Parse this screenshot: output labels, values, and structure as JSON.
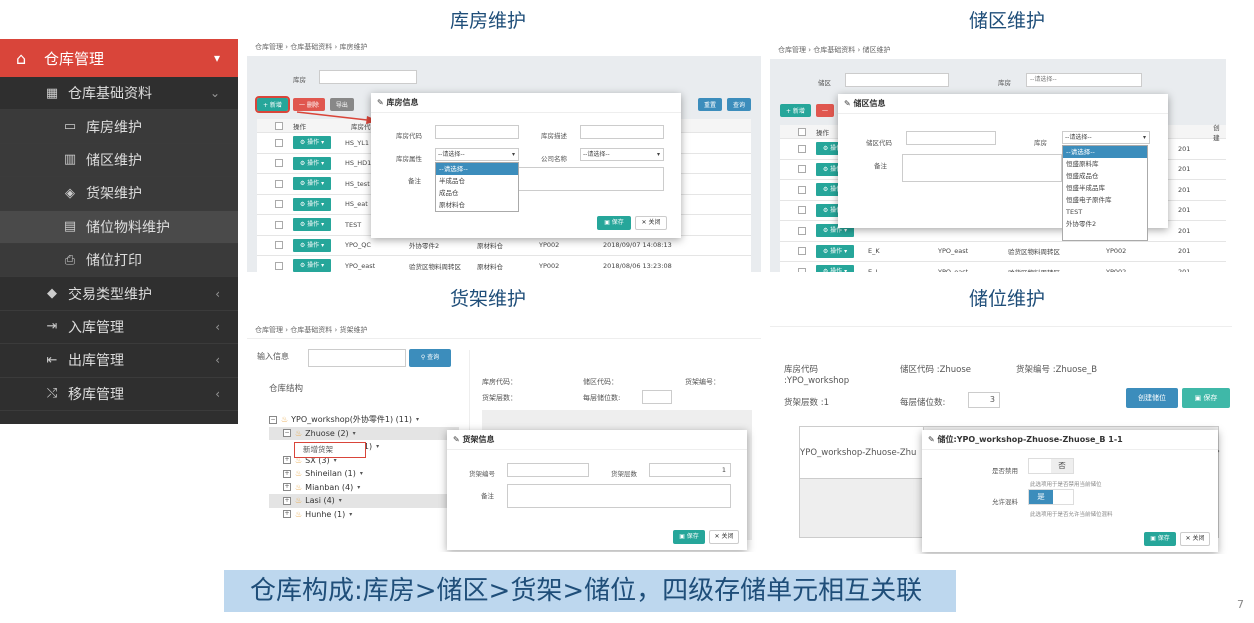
{
  "titles": {
    "warehouse": "库房维护",
    "zone": "储区维护",
    "rack": "货架维护",
    "location": "储位维护"
  },
  "sidebar": {
    "header": "仓库管理",
    "items": [
      {
        "label": "仓库基础资料",
        "level": 1,
        "icon": "grid-icon",
        "chevron": "down"
      },
      {
        "label": "库房维护",
        "level": 2,
        "icon": "inbox-icon"
      },
      {
        "label": "储区维护",
        "level": 2,
        "icon": "map-icon"
      },
      {
        "label": "货架维护",
        "level": 2,
        "icon": "layers-icon"
      },
      {
        "label": "储位物料维护",
        "level": 2,
        "icon": "film-icon",
        "active": true
      },
      {
        "label": "储位打印",
        "level": 2,
        "icon": "printer-icon"
      },
      {
        "label": "交易类型维护",
        "level": 1,
        "icon": "tag-icon",
        "chevron": "left"
      },
      {
        "label": "入库管理",
        "level": 1,
        "icon": "sign-in-icon",
        "chevron": "left"
      },
      {
        "label": "出库管理",
        "level": 1,
        "icon": "sign-out-icon",
        "chevron": "left"
      },
      {
        "label": "移库管理",
        "level": 1,
        "icon": "shuffle-icon",
        "chevron": "left"
      }
    ]
  },
  "p1": {
    "breadcrumb": "仓库管理 › 仓库基础资料 › 库房维护",
    "filter_label": "库房",
    "btn_add": "+ 新增",
    "btn_del": "一 删除",
    "btn_export": "导出",
    "btn_reset": "重置",
    "btn_query": "查询",
    "col_op": "操作",
    "col_code": "库房代码",
    "col_time": "时间",
    "op_label": "操作",
    "rows": [
      {
        "code": "HS_YL1",
        "a": "",
        "b": "",
        "c": "",
        "time": "/11/09 10:00:38"
      },
      {
        "code": "HS_HD1",
        "a": "",
        "b": "",
        "c": "",
        "time": "/11/09 10:00:03"
      },
      {
        "code": "HS_test",
        "a": "",
        "b": "",
        "c": "",
        "time": "/11/09 09:59:05"
      },
      {
        "code": "HS_eat",
        "a": "",
        "b": "",
        "c": "",
        "time": "/11/09 09:58:41"
      },
      {
        "code": "TEST",
        "a": "",
        "b": "",
        "c": "",
        "time": "/11/05 21:57:14"
      },
      {
        "code": "YPO_QC",
        "a": "外协零件2",
        "b": "原材料仓",
        "c": "YP002",
        "time": "2018/09/07 14:08:13"
      },
      {
        "code": "YPO_east",
        "a": "验货区物料周转区",
        "b": "原材料仓",
        "c": "YP002",
        "time": "2018/08/06 13:23:08"
      }
    ],
    "modal": {
      "title": "库房信息",
      "code_label": "库房代码",
      "desc_label": "库房描述",
      "attr_label": "库房属性",
      "company_label": "公司名称",
      "remark_label": "备注",
      "attr_value": "--请选择--",
      "company_value": "--请选择--",
      "options": [
        "--请选择--",
        "半成品仓",
        "成品仓",
        "原材料仓"
      ],
      "save": "保存",
      "close": "关闭"
    }
  },
  "p2": {
    "breadcrumb": "仓库管理 › 仓库基础资料 › 储区维护",
    "filter_zone": "储区",
    "filter_wh": "库房",
    "filter_wh_value": "--请选择--",
    "btn_add": "+ 新增",
    "col_op": "操作",
    "col_create": "创建",
    "op_label": "操作",
    "rows": [
      {
        "code": "",
        "wh": "",
        "zone": "",
        "c": "",
        "d": "201"
      },
      {
        "code": "",
        "wh": "",
        "zone": "",
        "c": "",
        "d": "201"
      },
      {
        "code": "",
        "wh": "",
        "zone": "",
        "c": "",
        "d": "201"
      },
      {
        "code": "",
        "wh": "",
        "zone": "",
        "c": "",
        "d": "201"
      },
      {
        "code": "",
        "wh": "",
        "zone": "",
        "c": "",
        "d": "201"
      },
      {
        "code": "E_K",
        "wh": "YPO_east",
        "zone": "验货区物料周转区",
        "c": "YP002",
        "d": "201"
      },
      {
        "code": "E_J",
        "wh": "YPO_east",
        "zone": "验货区物料周转区...",
        "c": "YP002",
        "d": "201"
      }
    ],
    "modal": {
      "title": "储区信息",
      "code_label": "储区代码",
      "wh_label": "库房",
      "remark_label": "备注",
      "wh_value": "--请选择--",
      "options": [
        "--请选择--",
        "恒盛原料库",
        "恒盛成品仓",
        "恒盛半成品库",
        "恒盛电子原件库",
        "TEST",
        "外协零件2"
      ]
    }
  },
  "p3": {
    "breadcrumb": "仓库管理 › 仓库基础资料 › 货架维护",
    "input_label": "输入信息",
    "query": "查询",
    "tree_title": "仓库结构",
    "tree": [
      {
        "label": "YPO_workshop(外协零件1) (11)",
        "indent": 0,
        "pm": "−"
      },
      {
        "label": "Zhuose (2)",
        "indent": 1,
        "pm": "−",
        "hl": true
      },
      {
        "label": "Zhuose_A (1)",
        "indent": 2,
        "pm": ""
      },
      {
        "label": "SX (3)",
        "indent": 1,
        "pm": "+"
      },
      {
        "label": "Shineilan (1)",
        "indent": 1,
        "pm": "+"
      },
      {
        "label": "Mianban (4)",
        "indent": 1,
        "pm": "+"
      },
      {
        "label": "Lasi (4)",
        "indent": 1,
        "pm": "+",
        "hl": true
      },
      {
        "label": "Hunhe (1)",
        "indent": 1,
        "pm": "+"
      }
    ],
    "context_menu": "新增货架",
    "info_wh": "库房代码：",
    "info_zone": "储区代码：",
    "info_rack": "货架编号：",
    "info_layers": "货架层数：",
    "info_per_layer": "每层储位数:",
    "modal": {
      "title": "货架信息",
      "rack_label": "货架编号",
      "layers_label": "货架层数",
      "layers_value": "1",
      "remark_label": "备注",
      "save": "保存",
      "close": "关闭"
    }
  },
  "p4": {
    "wh_code": "库房代码",
    "wh_value": ":YPO_workshop",
    "zone_code": "储区代码 :Zhuose",
    "rack_code": "货架编号 :Zhuose_B",
    "layers": "货架层数 :1",
    "per_layer_label": "每层储位数:",
    "per_layer_value": "3",
    "btn_create": "创建储位",
    "btn_save": "保存",
    "cell_text": "YPO_workshop-Zhuose-Zhu",
    "modal": {
      "title": "储位:YPO_workshop-Zhuose-Zhuose_B 1-1",
      "disable_label": "是否禁用",
      "disable_value": "否",
      "disable_hint": "此选项用于是否禁用当前储位",
      "mix_label": "允许混料",
      "mix_value": "是",
      "mix_hint": "此选项用于是否允许当前储位混料",
      "save": "保存",
      "close": "关闭"
    }
  },
  "caption": "仓库构成:库房>储区>货架>储位，四级存储单元相互关联",
  "page_number": "7",
  "colors": {
    "sidebar_accent": "#d9453a",
    "primary_green": "#26a69a",
    "primary_blue": "#3c8dbc",
    "caption_bg": "#bdd7ee"
  }
}
